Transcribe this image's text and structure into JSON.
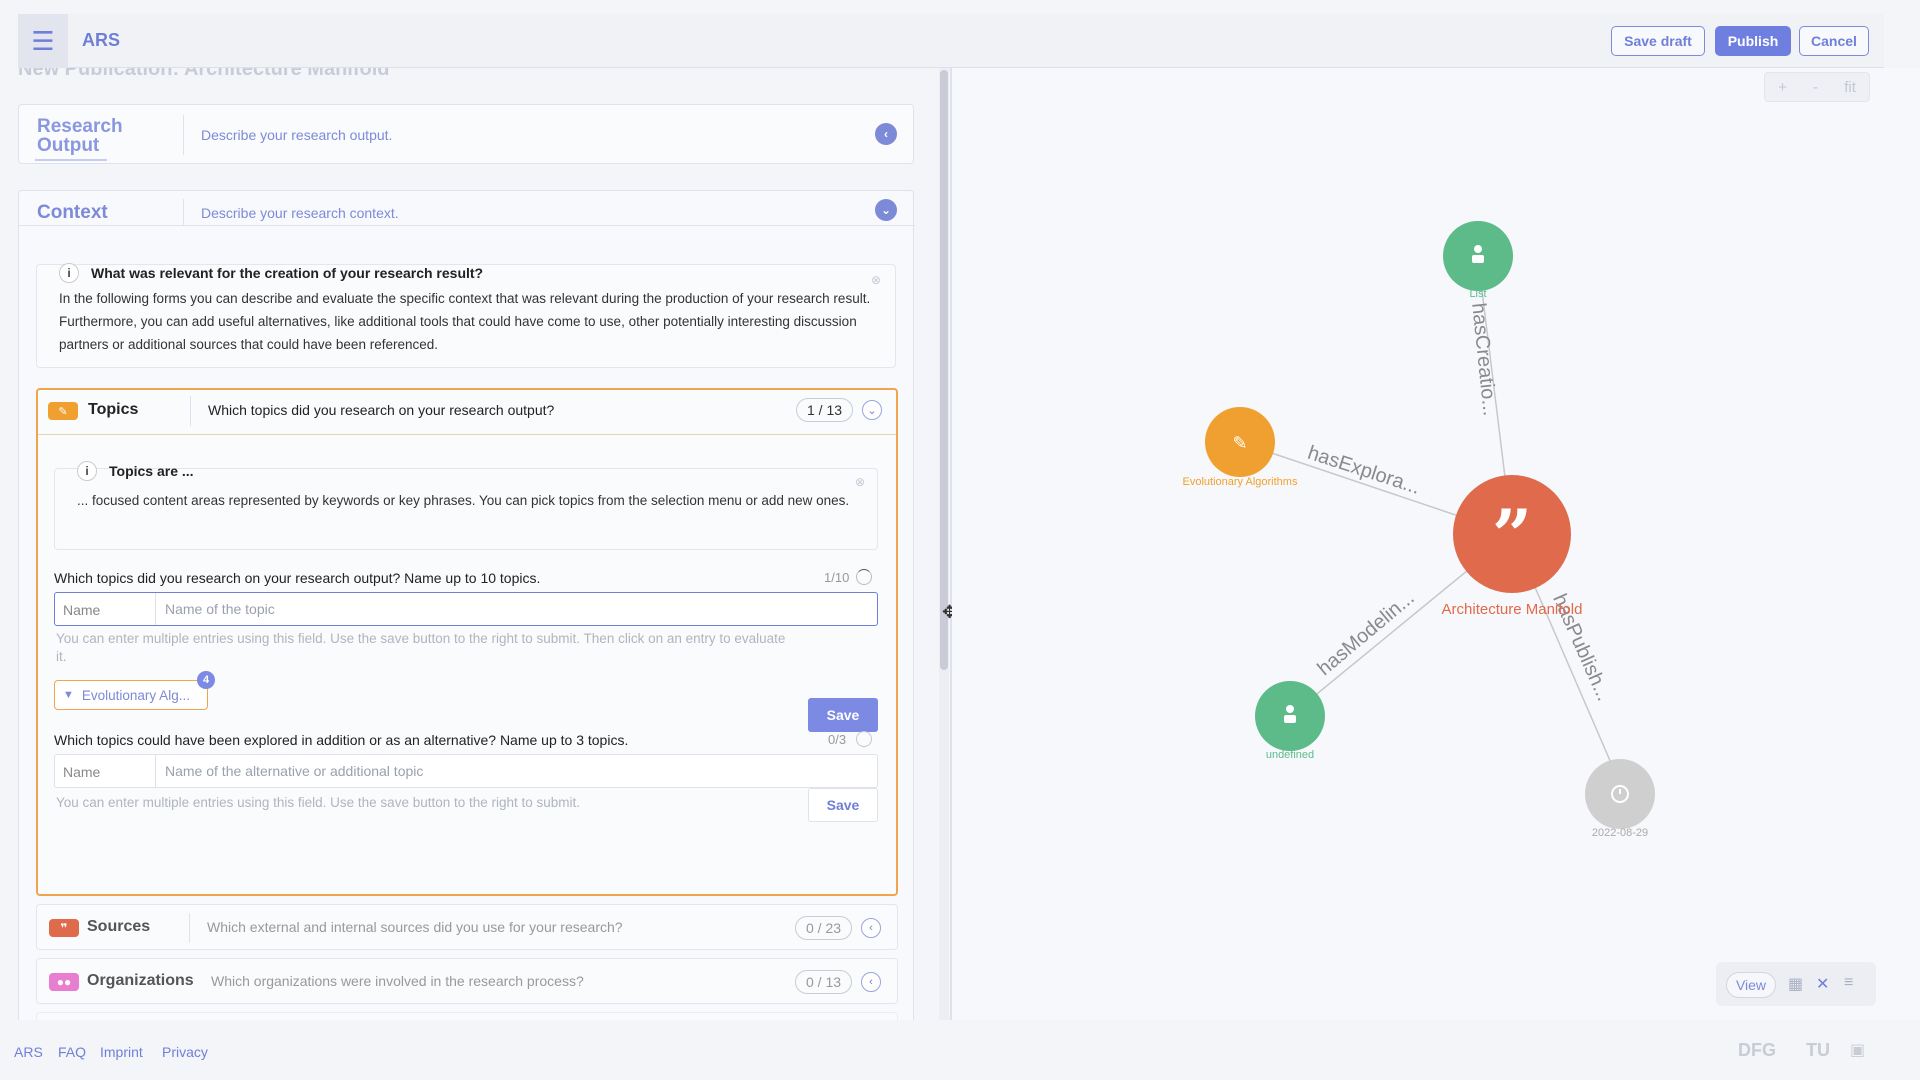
{
  "app": {
    "name": "ARS",
    "faded_title": "New Publication: Architecture Manifold"
  },
  "toolbar": {
    "save_draft": "Save draft",
    "publish": "Publish",
    "cancel": "Cancel"
  },
  "research_output": {
    "title_line1": "Research",
    "title_line2": "Output",
    "description": "Describe your research output."
  },
  "context": {
    "title": "Context",
    "description": "Describe your research context.",
    "info_heading": "What was relevant for the creation of your research result?",
    "info_text": "In the following forms you can describe and evaluate the specific context that was relevant during the production of your research result. Furthermore, you can add useful alternatives, like additional tools that could have come to use, other potentially interesting discussion partners or additional sources that could have been referenced."
  },
  "topics": {
    "title": "Topics",
    "question": "Which topics did you research on your research output?",
    "counter": "1 / 13",
    "info_heading": "Topics are ...",
    "info_text": "... focused content areas represented by keywords or key phrases. You can pick topics from the selection menu or add new ones.",
    "q1_label": "Which topics did you research on your research output? Name up to 10 topics.",
    "q1_count": "1/10",
    "q1_input_label": "Name",
    "q1_placeholder": "Name of the topic",
    "q1_hint": "You can enter multiple entries using this field. Use the save button to the right to submit. Then click on an entry to evaluate it.",
    "save_label": "Save",
    "chip_label": "Evolutionary Alg...",
    "chip_badge": "4",
    "q2_label": "Which topics could have been explored in addition or as an alternative? Name up to 3 topics.",
    "q2_count": "0/3",
    "q2_input_label": "Name",
    "q2_placeholder": "Name of the alternative or additional topic",
    "q2_hint": "You can enter multiple entries using this field. Use the save button to the right to submit."
  },
  "sources": {
    "title": "Sources",
    "question": "Which external and internal sources did you use for your research?",
    "counter": "0 / 23"
  },
  "organizations": {
    "title": "Organizations",
    "question": "Which organizations were involved in the research process?",
    "counter": "0 / 13"
  },
  "graph": {
    "zoom_in": "+",
    "zoom_out": "-",
    "fit": "fit",
    "center_label": "Architecture Manifold",
    "nodes": {
      "list": "List",
      "evolutionary": "Evolutionary Algorithms",
      "undefined": "undefined",
      "date": "2022-08-29"
    },
    "edges": {
      "creation": "hasCreatio...",
      "exploration": "hasExplora...",
      "modeling": "hasModelin...",
      "publish": "hasPublish..."
    },
    "view_label": "View",
    "colors": {
      "center": "#e06a4c",
      "green": "#5dbb8a",
      "orange": "#f0a030",
      "gray": "#cfcfcf"
    }
  },
  "footer": {
    "links": [
      "ARS",
      "FAQ",
      "Imprint",
      "Privacy"
    ],
    "logos": [
      "DFG",
      "TU"
    ]
  }
}
